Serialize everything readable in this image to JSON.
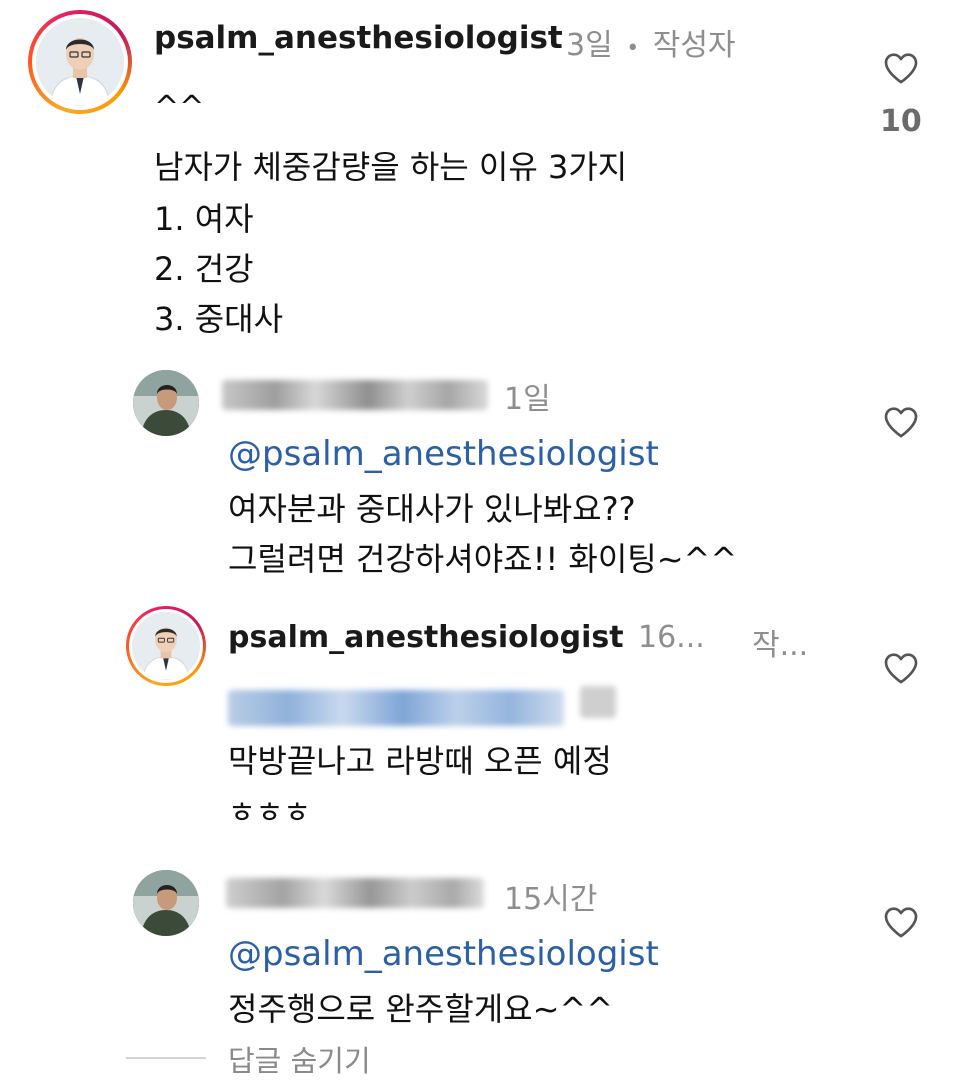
{
  "comments": [
    {
      "username": "psalm_anesthesiologist",
      "time": "3일",
      "dot": "•",
      "author_badge": "작성자",
      "lines": [
        "^^",
        "남자가 체중감량을 하는 이유 3가지",
        "1. 여자",
        "2. 건강",
        "3. 중대사"
      ],
      "likes": "10",
      "avatar_icon": "doctor-avatar-icon"
    },
    {
      "username": "",
      "time": "1일",
      "mention": "@psalm_anesthesiologist",
      "lines": [
        "여자분과 중대사가 있나봐요??",
        "그럴려면 건강하셔야죠!! 화이팅~^^"
      ],
      "avatar_icon": "user-avatar-icon"
    },
    {
      "username": "psalm_anesthesiologist",
      "time": "16...",
      "author_badge": "작...",
      "mention": "",
      "lines": [
        "막방끝나고 라방때 오픈 예정",
        "ㅎㅎㅎ"
      ],
      "avatar_icon": "doctor-avatar-icon"
    },
    {
      "username": "",
      "time": "15시간",
      "mention": "@psalm_anesthesiologist",
      "lines": [
        "정주행으로 완주할게요~^^"
      ],
      "avatar_icon": "user-avatar-icon"
    }
  ],
  "hide_replies_label": "답글 숨기기",
  "icons": {
    "like": "heart-outline-icon"
  },
  "colors": {
    "mention": "#2b5fa8",
    "meta": "#8e8e8e",
    "text": "#111111"
  }
}
